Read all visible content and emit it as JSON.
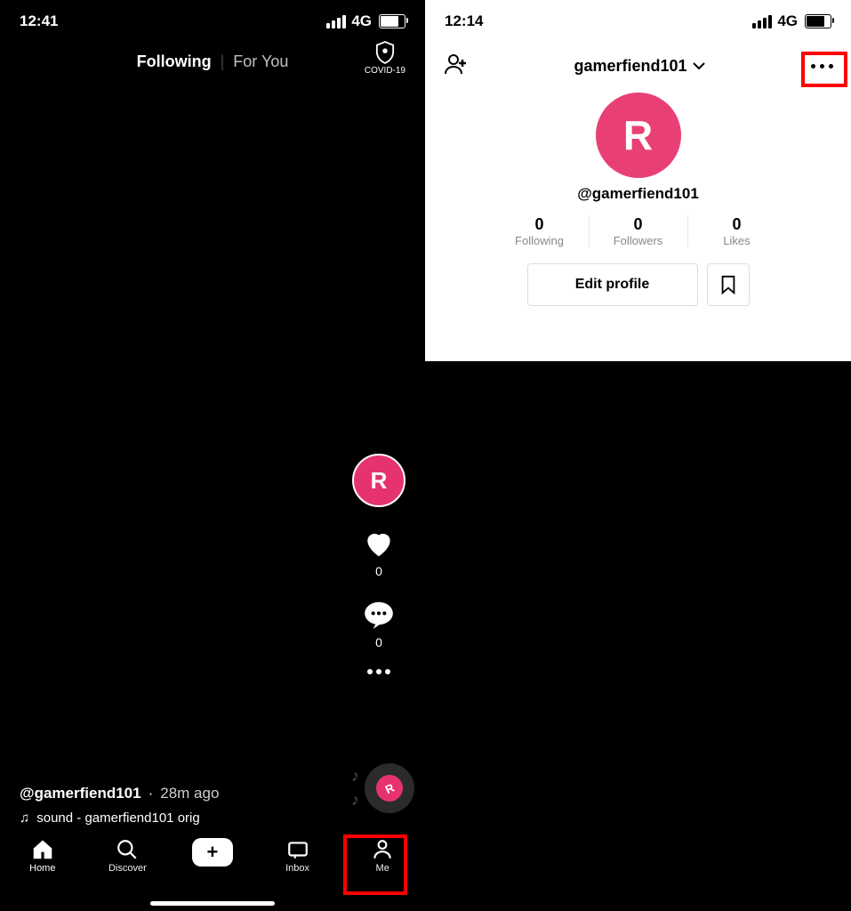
{
  "left": {
    "status": {
      "time": "12:41",
      "network": "4G"
    },
    "tabs": {
      "following": "Following",
      "foryou": "For You"
    },
    "covid_label": "COVID-19",
    "rail": {
      "avatar_letter": "R",
      "likes_count": "0",
      "comments_count": "0"
    },
    "caption": {
      "user": "@gamerfiend101",
      "time": "28m ago"
    },
    "sound": {
      "text": "sound - gamerfiend101   orig"
    },
    "disc_letter": "R",
    "tabbar": {
      "home": "Home",
      "discover": "Discover",
      "inbox": "Inbox",
      "me": "Me"
    }
  },
  "right": {
    "status": {
      "time": "12:14",
      "network": "4G"
    },
    "username": "gamerfiend101",
    "avatar_letter": "R",
    "handle": "@gamerfiend101",
    "stats": {
      "following": {
        "num": "0",
        "label": "Following"
      },
      "followers": {
        "num": "0",
        "label": "Followers"
      },
      "likes": {
        "num": "0",
        "label": "Likes"
      }
    },
    "edit_label": "Edit profile"
  }
}
